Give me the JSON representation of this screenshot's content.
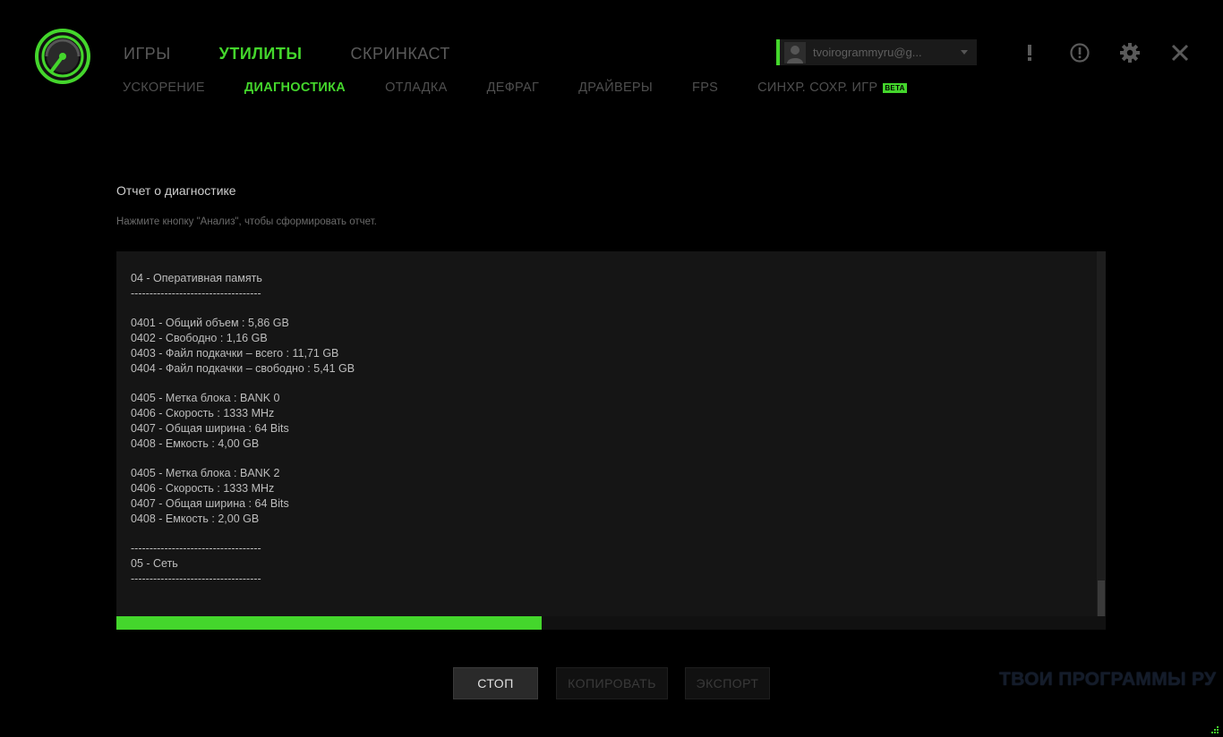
{
  "main_nav": {
    "items": [
      {
        "label": "ИГРЫ",
        "active": false
      },
      {
        "label": "УТИЛИТЫ",
        "active": true
      },
      {
        "label": "СКРИНКАСТ",
        "active": false
      }
    ]
  },
  "sub_nav": {
    "items": [
      {
        "label": "УСКОРЕНИЕ",
        "active": false
      },
      {
        "label": "ДИАГНОСТИКА",
        "active": true
      },
      {
        "label": "ОТЛАДКА",
        "active": false
      },
      {
        "label": "ДЕФРАГ",
        "active": false
      },
      {
        "label": "ДРАЙВЕРЫ",
        "active": false
      },
      {
        "label": "FPS",
        "active": false
      },
      {
        "label": "СИНХР. СОХР. ИГР",
        "active": false
      }
    ],
    "beta_label": "BETA"
  },
  "account": {
    "email": "tvoirogrammyru@g..."
  },
  "icons": [
    "logo-icon",
    "alert-icon",
    "info-icon",
    "settings-icon",
    "close-icon",
    "avatar-icon",
    "dropdown-caret-icon"
  ],
  "report": {
    "title": "Отчет о диагностике",
    "hint": "Нажмите кнопку \"Анализ\", чтобы сформировать отчет.",
    "lines": [
      "04 - Оперативная память",
      "-----------------------------------",
      "",
      "0401 - Общий объем : 5,86 GB",
      "0402 - Свободно : 1,16 GB",
      "0403 - Файл подкачки – всего : 11,71 GB",
      "0404 - Файл подкачки – свободно : 5,41 GB",
      "",
      "0405 - Метка блока : BANK 0",
      "0406 - Скорость : 1333 MHz",
      "0407 - Общая ширина : 64 Bits",
      "0408 - Емкость : 4,00 GB",
      "",
      "0405 - Метка блока : BANK 2",
      "0406 - Скорость : 1333 MHz",
      "0407 - Общая ширина : 64 Bits",
      "0408 - Емкость : 2,00 GB",
      "",
      "-----------------------------------",
      "05 - Сеть",
      "-----------------------------------"
    ]
  },
  "progress": {
    "fraction": 0.43
  },
  "buttons": {
    "stop": "СТОП",
    "copy": "КОПИРОВАТЬ",
    "export": "ЭКСПОРТ"
  },
  "watermark": "ТВОИ ПРОГРАММЫ РУ",
  "colors": {
    "accent": "#44d62c",
    "background": "#000000",
    "panel": "#151515"
  }
}
